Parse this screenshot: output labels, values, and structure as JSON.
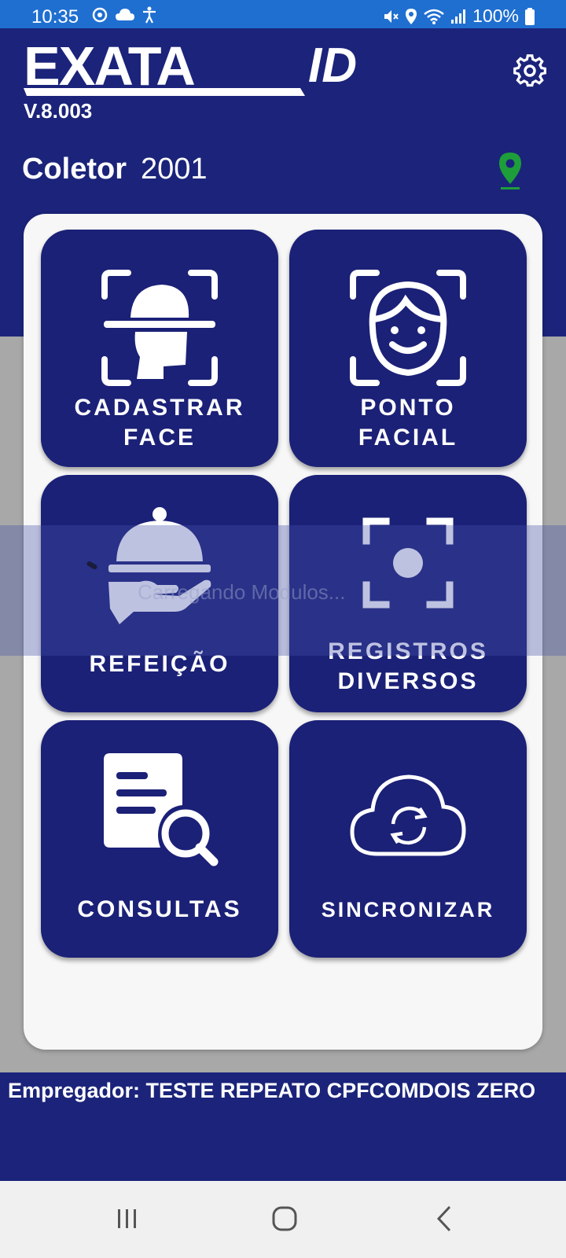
{
  "status_bar": {
    "time": "10:35",
    "battery": "100%"
  },
  "header": {
    "logo_text": "EXATAID",
    "version": "V.8.003",
    "collector_label": "Coletor",
    "collector_value": "2001"
  },
  "tiles": [
    {
      "id": "cadastrar-face",
      "line1": "CADASTRAR",
      "line2": "FACE",
      "icon": "face-scan-icon"
    },
    {
      "id": "ponto-facial",
      "line1": "PONTO",
      "line2": "FACIAL",
      "icon": "face-icon"
    },
    {
      "id": "refeicao",
      "line1": "REFEIÇÃO",
      "line2": "",
      "icon": "meal-cloche-icon"
    },
    {
      "id": "registros-diversos",
      "line1": "REGISTROS",
      "line2": "DIVERSOS",
      "icon": "focus-target-icon"
    },
    {
      "id": "consultas",
      "line1": "CONSULTAS",
      "line2": "",
      "icon": "document-search-icon"
    },
    {
      "id": "sincronizar",
      "line1": "SINCRONIZAR",
      "line2": "",
      "icon": "cloud-sync-icon"
    }
  ],
  "loading": {
    "text": "Carregando Modulos..."
  },
  "footer": {
    "employer_text": "Empregador: TESTE REPEATO CPFCOMDOIS ZERO"
  },
  "colors": {
    "status_bar": "#1f6fd1",
    "header": "#1b247a",
    "tile": "#1b2177",
    "pin": "#1e9e3a",
    "panel": "#f7f7f7"
  }
}
